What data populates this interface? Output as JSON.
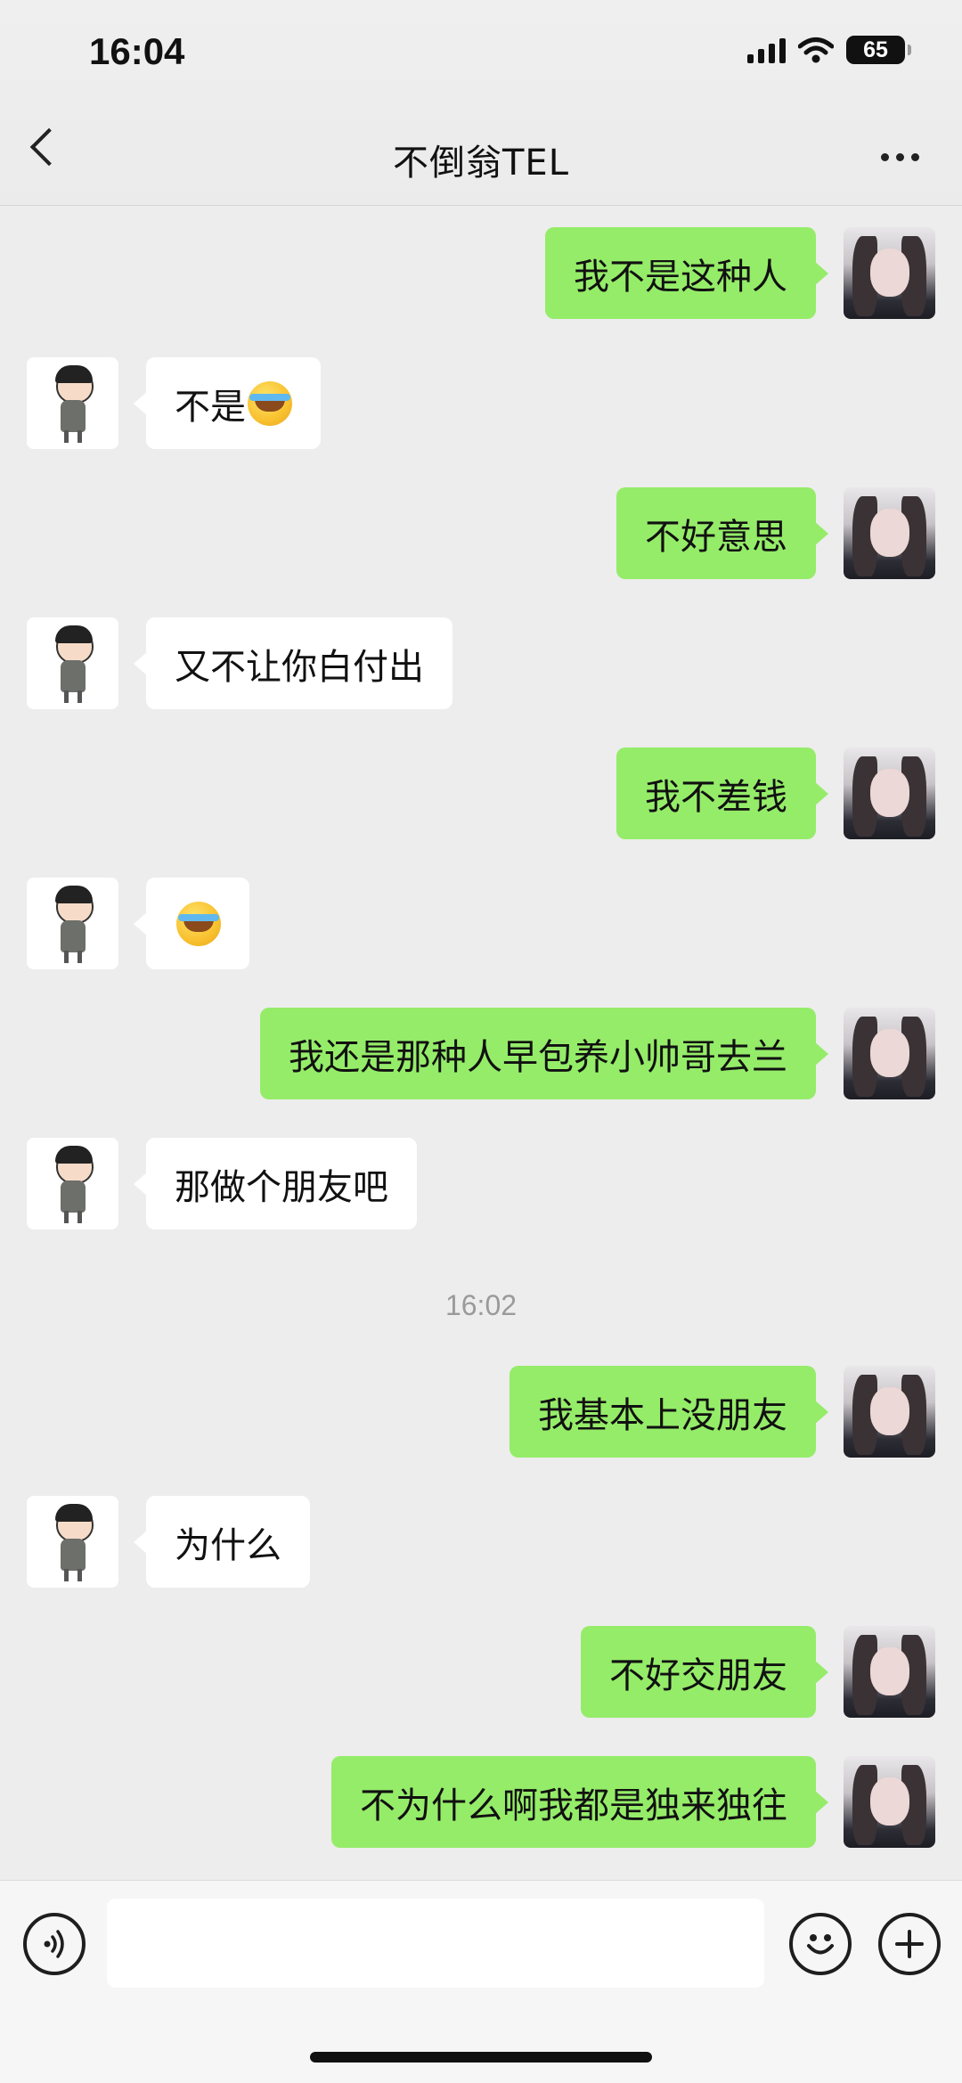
{
  "status_bar": {
    "time": "16:04",
    "battery": "65"
  },
  "header": {
    "title": "不倒翁TEL"
  },
  "messages": [
    {
      "side": "right",
      "text": "我不是这种人"
    },
    {
      "side": "left",
      "text": "不是",
      "emoji": "laugh-cry"
    },
    {
      "side": "right",
      "text": "不好意思"
    },
    {
      "side": "left",
      "text": "又不让你白付出"
    },
    {
      "side": "right",
      "text": "我不差钱"
    },
    {
      "side": "left",
      "text": "",
      "emoji": "laugh-cry"
    },
    {
      "side": "right",
      "text": "我还是那种人早包养小帅哥去兰"
    },
    {
      "side": "left",
      "text": "那做个朋友吧"
    },
    {
      "side": "right",
      "text": "我基本上没朋友"
    },
    {
      "side": "left",
      "text": "为什么"
    },
    {
      "side": "right",
      "text": "不好交朋友"
    },
    {
      "side": "right",
      "text": "不为什么啊我都是独来独往"
    }
  ],
  "timestamp": "16:02",
  "input_bar": {
    "message_value": "",
    "voice_icon": "voice-icon",
    "emoji_icon": "emoji-icon",
    "plus_icon": "plus-icon"
  },
  "colors": {
    "sent_bubble": "#95ec69",
    "received_bubble": "#ffffff",
    "background": "#ededed"
  }
}
